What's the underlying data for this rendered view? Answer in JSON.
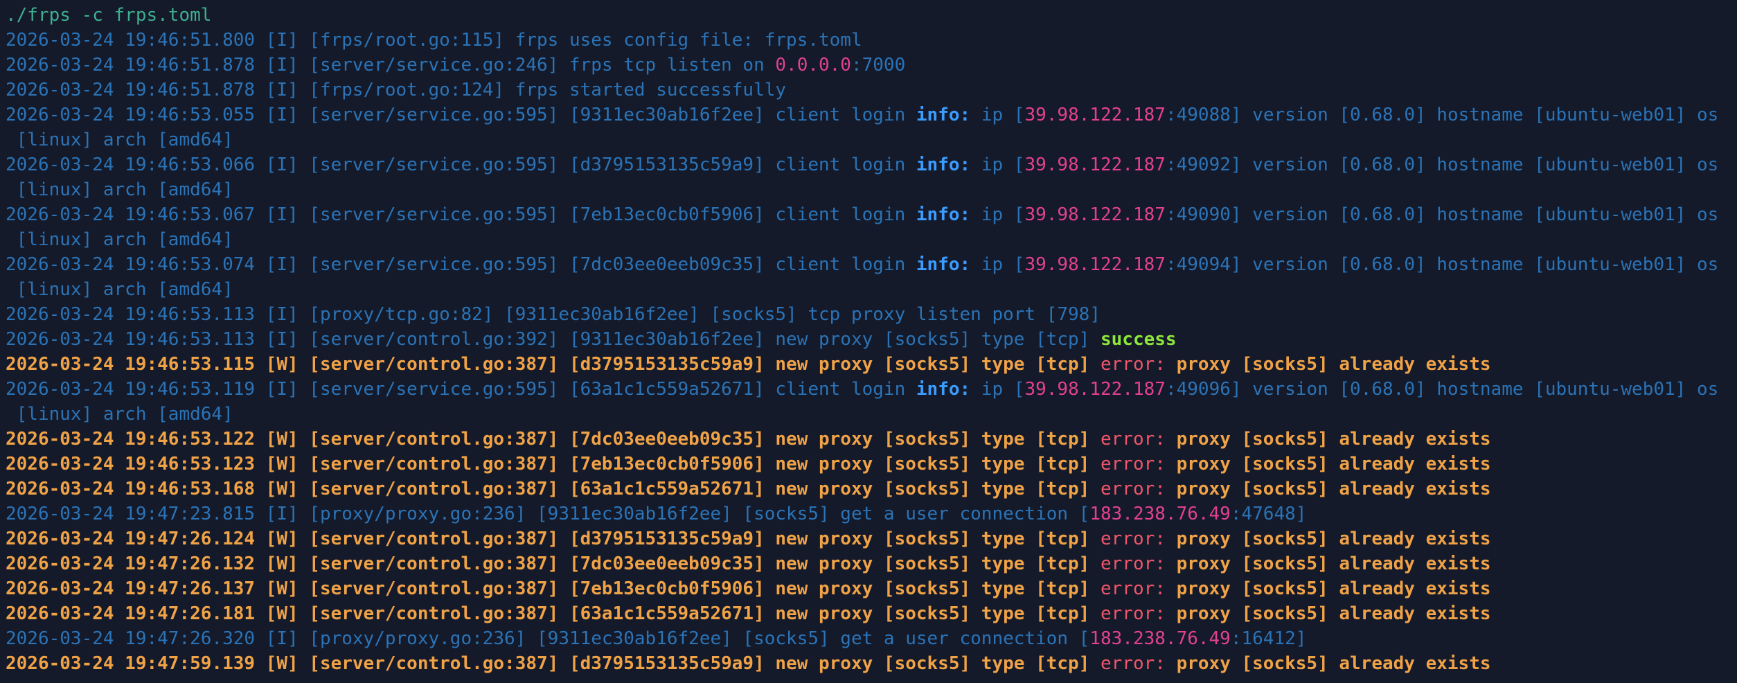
{
  "terminal": {
    "command": "./frps -c frps.toml",
    "lines": [
      {
        "level": "I",
        "segs": [
          {
            "t": "2026-03-24 19:46:51.800 [I] [frps/root.go:115] frps uses config file: frps.toml"
          }
        ]
      },
      {
        "level": "I",
        "segs": [
          {
            "t": "2026-03-24 19:46:51.878 [I] [server/service.go:246] frps tcp listen on "
          },
          {
            "t": "0.0.0.0",
            "c": "ip"
          },
          {
            "t": ":7000"
          }
        ]
      },
      {
        "level": "I",
        "segs": [
          {
            "t": "2026-03-24 19:46:51.878 [I] [frps/root.go:124] frps started successfully"
          }
        ]
      },
      {
        "level": "I",
        "segs": [
          {
            "t": "2026-03-24 19:46:53.055 [I] [server/service.go:595] [9311ec30ab16f2ee] client login "
          },
          {
            "t": "info:",
            "c": "info"
          },
          {
            "t": " ip ["
          },
          {
            "t": "39.98.122.187",
            "c": "ip"
          },
          {
            "t": ":49088] version [0.68.0] hostname [ubuntu-web01] os"
          }
        ]
      },
      {
        "level": "I",
        "segs": [
          {
            "t": " [linux] arch [amd64]"
          }
        ]
      },
      {
        "level": "I",
        "segs": [
          {
            "t": "2026-03-24 19:46:53.066 [I] [server/service.go:595] [d3795153135c59a9] client login "
          },
          {
            "t": "info:",
            "c": "info"
          },
          {
            "t": " ip ["
          },
          {
            "t": "39.98.122.187",
            "c": "ip"
          },
          {
            "t": ":49092] version [0.68.0] hostname [ubuntu-web01] os"
          }
        ]
      },
      {
        "level": "I",
        "segs": [
          {
            "t": " [linux] arch [amd64]"
          }
        ]
      },
      {
        "level": "I",
        "segs": [
          {
            "t": "2026-03-24 19:46:53.067 [I] [server/service.go:595] [7eb13ec0cb0f5906] client login "
          },
          {
            "t": "info:",
            "c": "info"
          },
          {
            "t": " ip ["
          },
          {
            "t": "39.98.122.187",
            "c": "ip"
          },
          {
            "t": ":49090] version [0.68.0] hostname [ubuntu-web01] os"
          }
        ]
      },
      {
        "level": "I",
        "segs": [
          {
            "t": " [linux] arch [amd64]"
          }
        ]
      },
      {
        "level": "I",
        "segs": [
          {
            "t": "2026-03-24 19:46:53.074 [I] [server/service.go:595] [7dc03ee0eeb09c35] client login "
          },
          {
            "t": "info:",
            "c": "info"
          },
          {
            "t": " ip ["
          },
          {
            "t": "39.98.122.187",
            "c": "ip"
          },
          {
            "t": ":49094] version [0.68.0] hostname [ubuntu-web01] os"
          }
        ]
      },
      {
        "level": "I",
        "segs": [
          {
            "t": " [linux] arch [amd64]"
          }
        ]
      },
      {
        "level": "I",
        "segs": [
          {
            "t": "2026-03-24 19:46:53.113 [I] [proxy/tcp.go:82] [9311ec30ab16f2ee] [socks5] tcp proxy listen port [798]"
          }
        ]
      },
      {
        "level": "I",
        "segs": [
          {
            "t": "2026-03-24 19:46:53.113 [I] [server/control.go:392] [9311ec30ab16f2ee] new proxy [socks5] type [tcp] "
          },
          {
            "t": "success",
            "c": "success"
          }
        ]
      },
      {
        "level": "W",
        "segs": [
          {
            "t": "2026-03-24 19:46:53.115 [W] [server/control.go:387] [d3795153135c59a9] new proxy [socks5] type [tcp] "
          },
          {
            "t": "error:",
            "c": "err"
          },
          {
            "t": " proxy [socks5] already exists"
          }
        ]
      },
      {
        "level": "I",
        "segs": [
          {
            "t": "2026-03-24 19:46:53.119 [I] [server/service.go:595] [63a1c1c559a52671] client login "
          },
          {
            "t": "info:",
            "c": "info"
          },
          {
            "t": " ip ["
          },
          {
            "t": "39.98.122.187",
            "c": "ip"
          },
          {
            "t": ":49096] version [0.68.0] hostname [ubuntu-web01] os"
          }
        ]
      },
      {
        "level": "I",
        "segs": [
          {
            "t": " [linux] arch [amd64]"
          }
        ]
      },
      {
        "level": "W",
        "segs": [
          {
            "t": "2026-03-24 19:46:53.122 [W] [server/control.go:387] [7dc03ee0eeb09c35] new proxy [socks5] type [tcp] "
          },
          {
            "t": "error:",
            "c": "err"
          },
          {
            "t": " proxy [socks5] already exists"
          }
        ]
      },
      {
        "level": "W",
        "segs": [
          {
            "t": "2026-03-24 19:46:53.123 [W] [server/control.go:387] [7eb13ec0cb0f5906] new proxy [socks5] type [tcp] "
          },
          {
            "t": "error:",
            "c": "err"
          },
          {
            "t": " proxy [socks5] already exists"
          }
        ]
      },
      {
        "level": "W",
        "segs": [
          {
            "t": "2026-03-24 19:46:53.168 [W] [server/control.go:387] [63a1c1c559a52671] new proxy [socks5] type [tcp] "
          },
          {
            "t": "error:",
            "c": "err"
          },
          {
            "t": " proxy [socks5] already exists"
          }
        ]
      },
      {
        "level": "I",
        "segs": [
          {
            "t": "2026-03-24 19:47:23.815 [I] [proxy/proxy.go:236] [9311ec30ab16f2ee] [socks5] get a user connection ["
          },
          {
            "t": "183.238.76.49",
            "c": "ip"
          },
          {
            "t": ":47648]"
          }
        ]
      },
      {
        "level": "W",
        "segs": [
          {
            "t": "2026-03-24 19:47:26.124 [W] [server/control.go:387] [d3795153135c59a9] new proxy [socks5] type [tcp] "
          },
          {
            "t": "error:",
            "c": "err"
          },
          {
            "t": " proxy [socks5] already exists"
          }
        ]
      },
      {
        "level": "W",
        "segs": [
          {
            "t": "2026-03-24 19:47:26.132 [W] [server/control.go:387] [7dc03ee0eeb09c35] new proxy [socks5] type [tcp] "
          },
          {
            "t": "error:",
            "c": "err"
          },
          {
            "t": " proxy [socks5] already exists"
          }
        ]
      },
      {
        "level": "W",
        "segs": [
          {
            "t": "2026-03-24 19:47:26.137 [W] [server/control.go:387] [7eb13ec0cb0f5906] new proxy [socks5] type [tcp] "
          },
          {
            "t": "error:",
            "c": "err"
          },
          {
            "t": " proxy [socks5] already exists"
          }
        ]
      },
      {
        "level": "W",
        "segs": [
          {
            "t": "2026-03-24 19:47:26.181 [W] [server/control.go:387] [63a1c1c559a52671] new proxy [socks5] type [tcp] "
          },
          {
            "t": "error:",
            "c": "err"
          },
          {
            "t": " proxy [socks5] already exists"
          }
        ]
      },
      {
        "level": "I",
        "segs": [
          {
            "t": "2026-03-24 19:47:26.320 [I] [proxy/proxy.go:236] [9311ec30ab16f2ee] [socks5] get a user connection ["
          },
          {
            "t": "183.238.76.49",
            "c": "ip"
          },
          {
            "t": ":16412]"
          }
        ]
      },
      {
        "level": "W",
        "segs": [
          {
            "t": "2026-03-24 19:47:59.139 [W] [server/control.go:387] [d3795153135c59a9] new proxy [socks5] type [tcp] "
          },
          {
            "t": "error:",
            "c": "err"
          },
          {
            "t": " proxy [socks5] already exists"
          }
        ]
      }
    ]
  },
  "colors": {
    "background": "#141a2a",
    "info_text": "#2b73b6",
    "warn_text": "#f0a247",
    "ip_address": "#e1418f",
    "info_label": "#3b9cff",
    "success": "#8ee63a",
    "error_label": "#f0556a",
    "command": "#3fae8f"
  }
}
